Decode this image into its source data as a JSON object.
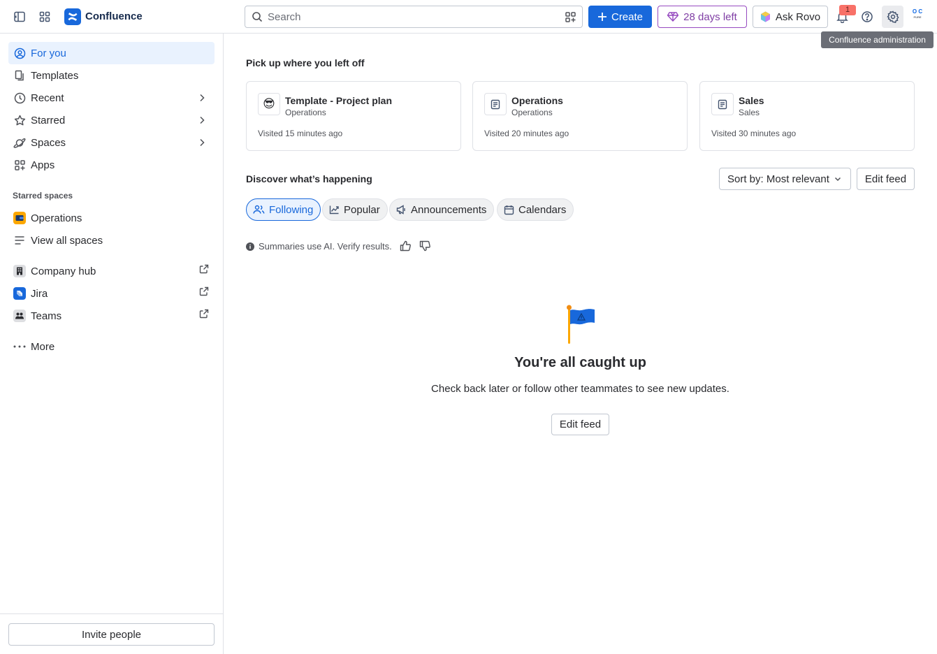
{
  "header": {
    "brand": "Confluence",
    "search_placeholder": "Search",
    "create_label": "Create",
    "trial_label": "28 days left",
    "rovo_label": "Ask Rovo",
    "notification_count": "1",
    "avatar_initials_top": "O C",
    "avatar_initials_bottom": "PURE",
    "tooltip": "Confluence administration",
    "icons": [
      "sidebar-toggle-icon",
      "app-switcher-icon",
      "confluence-logo",
      "search-icon",
      "filter-icon",
      "plus-icon",
      "diamond-icon",
      "rovo-icon",
      "bell-icon",
      "help-icon",
      "gear-icon"
    ],
    "colors": {
      "primary": "#1868db",
      "trial": "#803fa5",
      "badge": "#f87168"
    }
  },
  "sidebar": {
    "nav": [
      {
        "label": "For you",
        "icon": "user-circle-icon",
        "active": true
      },
      {
        "label": "Templates",
        "icon": "template-icon"
      },
      {
        "label": "Recent",
        "icon": "clock-icon",
        "chevron": true
      },
      {
        "label": "Starred",
        "icon": "star-icon",
        "chevron": true
      },
      {
        "label": "Spaces",
        "icon": "planet-icon",
        "chevron": true
      },
      {
        "label": "Apps",
        "icon": "apps-icon"
      }
    ],
    "starred_spaces_label": "Starred spaces",
    "starred_spaces": [
      {
        "label": "Operations",
        "icon": "space-icon"
      },
      {
        "label": "View all spaces",
        "icon": "list-icon"
      }
    ],
    "external": [
      {
        "label": "Company hub",
        "icon": "building-icon"
      },
      {
        "label": "Jira",
        "icon": "jira-icon"
      },
      {
        "label": "Teams",
        "icon": "teams-icon"
      }
    ],
    "more_label": "More",
    "invite_label": "Invite people"
  },
  "main": {
    "pickup_title": "Pick up where you left off",
    "recent_cards": [
      {
        "title": "Template - Project plan",
        "space": "Operations",
        "visited": "Visited 15 minutes ago",
        "icon": "sunglasses-emoji",
        "emoji": "😎"
      },
      {
        "title": "Operations",
        "space": "Operations",
        "visited": "Visited 20 minutes ago",
        "icon": "page-icon"
      },
      {
        "title": "Sales",
        "space": "Sales",
        "visited": "Visited 30 minutes ago",
        "icon": "page-icon"
      }
    ],
    "discover_title": "Discover what’s happening",
    "sort_label": "Sort by: Most relevant",
    "edit_feed_label": "Edit feed",
    "tabs": [
      {
        "label": "Following",
        "icon": "people-icon",
        "selected": true
      },
      {
        "label": "Popular",
        "icon": "trend-icon"
      },
      {
        "label": "Announcements",
        "icon": "megaphone-icon"
      },
      {
        "label": "Calendars",
        "icon": "calendar-icon"
      }
    ],
    "ai_note": "Summaries use AI. Verify results.",
    "empty_title": "You're all caught up",
    "empty_subtitle": "Check back later or follow other teammates to see new updates.",
    "empty_button": "Edit feed"
  }
}
